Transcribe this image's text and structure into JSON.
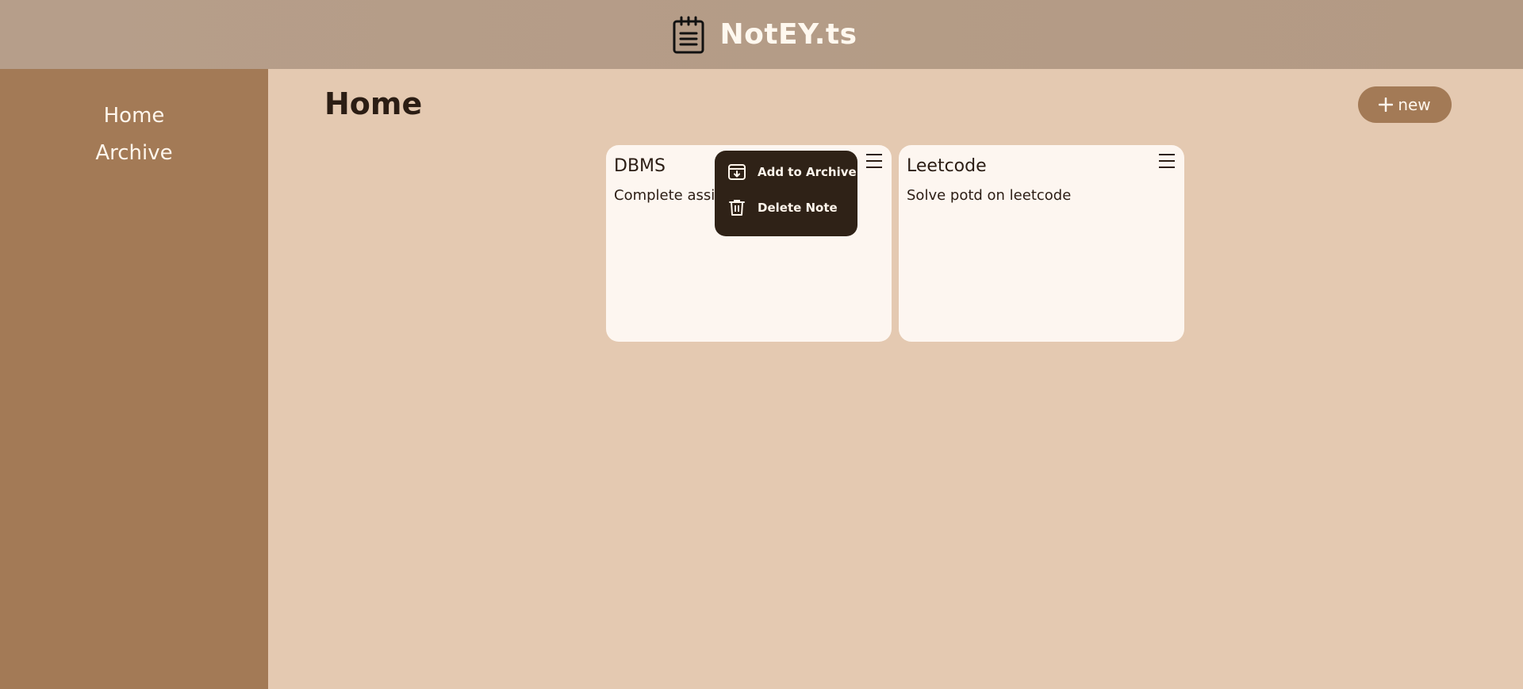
{
  "header": {
    "title": "NotEY.ts",
    "logo_icon": "notepad-icon"
  },
  "sidebar": {
    "items": [
      {
        "label": "Home"
      },
      {
        "label": "Archive"
      }
    ]
  },
  "main": {
    "page_title": "Home",
    "new_button": {
      "label": "new",
      "icon": "plus-icon"
    }
  },
  "notes": [
    {
      "title": "DBMS",
      "body": "Complete assignment 10 in file",
      "menu_icon": "hamburger-menu-icon"
    },
    {
      "title": "Leetcode",
      "body": "Solve potd on leetcode",
      "menu_icon": "hamburger-menu-icon"
    }
  ],
  "note_menu": {
    "items": [
      {
        "label": "Add to Archive",
        "icon": "archive-icon"
      },
      {
        "label": "Delete Note",
        "icon": "trash-icon"
      }
    ]
  },
  "colors": {
    "header_bg": "#b39a84",
    "sidebar_bg": "#a37a56",
    "page_bg": "#e4c9b1",
    "card_bg": "#fdf6f0",
    "menu_bg": "#2f2217",
    "text_dark": "#2b1d14",
    "text_light": "#fff6ec"
  }
}
